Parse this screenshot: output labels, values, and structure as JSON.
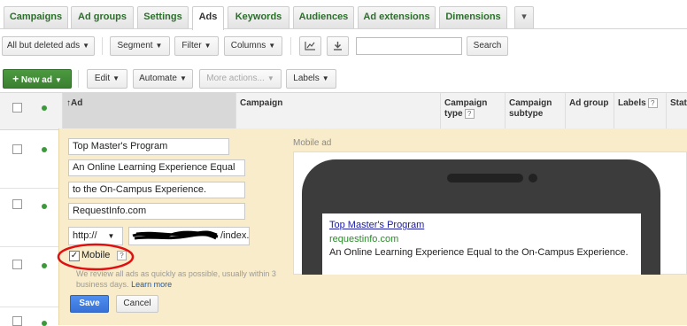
{
  "tabs": [
    "Campaigns",
    "Ad groups",
    "Settings",
    "Ads",
    "Keywords",
    "Audiences",
    "Ad extensions",
    "Dimensions"
  ],
  "active_tab": "Ads",
  "toolbar": {
    "filter_select": "All but deleted ads",
    "segment": "Segment",
    "filter": "Filter",
    "columns": "Columns",
    "search_value": "",
    "search_button": "Search"
  },
  "actions": {
    "new_ad": "New ad",
    "edit": "Edit",
    "automate": "Automate",
    "more_actions": "More actions...",
    "labels": "Labels"
  },
  "table": {
    "headers": {
      "ad": "Ad",
      "campaign": "Campaign",
      "campaign_type": "Campaign type",
      "campaign_subtype": "Campaign subtype",
      "ad_group": "Ad group",
      "labels": "Labels",
      "status": "Statu"
    }
  },
  "editor": {
    "headline": "Top Master's Program",
    "desc1": "An Online Learning Experience Equal",
    "desc2": "to the On-Campus Experience.",
    "display_url": "RequestInfo.com",
    "protocol": "http://",
    "final_url": "/index.",
    "mobile_label": "Mobile",
    "mobile_checked": true,
    "review_note": "We review all ads as quickly as possible, usually within 3 business days.",
    "learn_more": "Learn more",
    "save": "Save",
    "cancel": "Cancel"
  },
  "preview": {
    "label": "Mobile ad",
    "title": "Top Master's Program",
    "url": "requestinfo.com",
    "description": "An Online Learning Experience Equal to the On-Campus Experience."
  },
  "colors": {
    "panel_bg": "#f8eccb",
    "accent_green": "#3b7f31",
    "link_blue": "#1a1aa6",
    "highlight_red": "#e01010"
  }
}
